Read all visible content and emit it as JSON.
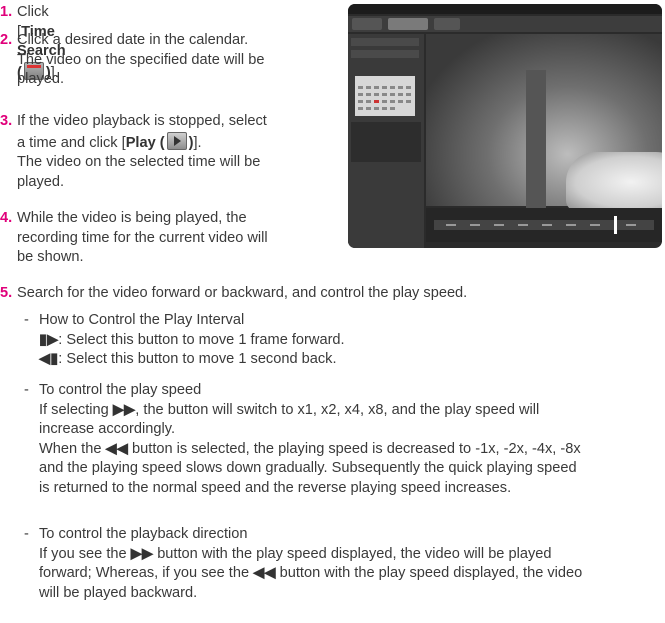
{
  "steps": [
    {
      "num": "1.",
      "pre": "Click [",
      "bold": "Time Search (",
      "bold_end": ")",
      "post": "]."
    },
    {
      "num": "2.",
      "lines": [
        "Click a desired date in the calendar.",
        "The video on the specified date will be",
        "played."
      ]
    },
    {
      "num": "3.",
      "lines_a": [
        "If the video playback is stopped, select",
        "a time and click ["
      ],
      "bold": "Play (",
      "bold_end": ")",
      "post": "].",
      "lines_b": [
        "The video on the selected time will be",
        "played."
      ]
    },
    {
      "num": "4.",
      "lines": [
        "While the video is being played, the",
        "recording time for the current video will",
        "be shown."
      ]
    },
    {
      "num": "5.",
      "lines": [
        "Search for the video forward or backward, and control the play speed."
      ]
    }
  ],
  "subs": [
    {
      "dash": "-",
      "title": "How to Control the Play Interval",
      "items": [
        {
          "glyph": "▮▶",
          "text": ": Select this button to move 1 frame forward."
        },
        {
          "glyph": "◀▮",
          "text": ": Select this button to move 1 second back."
        }
      ]
    },
    {
      "dash": "-",
      "title": "To control the play speed",
      "p1_a": "If selecting ",
      "p1_glyph": "▶▶",
      "p1_b": ", the button will switch to x1, x2, x4, x8, and the play speed will",
      "p1_c": "increase accordingly.",
      "p2_a": "When the ",
      "p2_glyph": "◀◀",
      "p2_b": " button is selected, the playing speed is decreased to -1x, -2x, -4x, -8x",
      "p2_c": "and the playing speed slows down gradually. Subsequently the quick playing speed",
      "p2_d": "is returned to the normal speed and the reverse playing speed increases."
    },
    {
      "dash": "-",
      "title": "To control the playback direction",
      "p1_a": "If you see the ",
      "p1_glyph": "▶▶",
      "p1_b": " button with the play speed displayed, the video will be played",
      "p1_c": "forward; Whereas, if you see the ",
      "p1_glyph2": "◀◀",
      "p1_d": " button with the play speed displayed, the video",
      "p1_e": "will be played backward."
    }
  ],
  "icons": {
    "calendar": "calendar-icon",
    "play": "play-icon"
  },
  "colors": {
    "step_number": "#e0007a",
    "text": "#3a3a3a"
  }
}
